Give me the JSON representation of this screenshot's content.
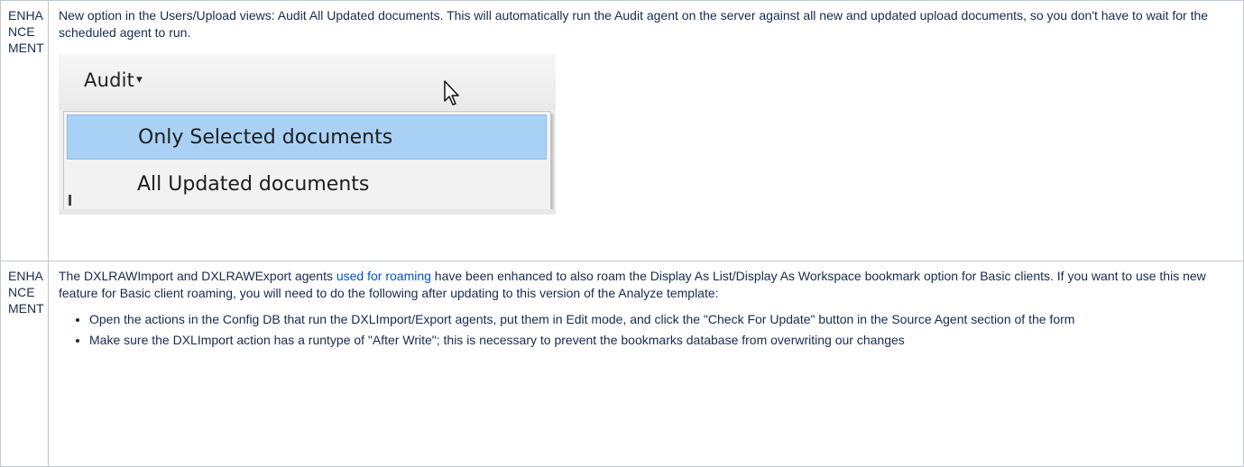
{
  "rows": [
    {
      "type": "ENHANCEMENT",
      "description": "New option in the Users/Upload views: Audit All Updated documents. This will automatically run the Audit agent on the server against all new and updated upload documents, so you don't have to wait for the scheduled agent to run.",
      "screenshot": {
        "menu_button": "Audit",
        "caret": "▾",
        "items": [
          "Only Selected documents",
          "All Updated documents"
        ],
        "selected_index": 0
      }
    },
    {
      "type": "ENHANCEMENT",
      "desc_before_link": "The DXLRAWImport and DXLRAWExport agents ",
      "link_text": "used for roaming",
      "desc_after_link": " have been enhanced to also roam the Display As List/Display As Workspace bookmark option for Basic clients. If you want to use this new feature for Basic client roaming, you will need to do the following after updating to this version of the Analyze template:",
      "bullets": [
        "Open the actions in the Config DB that run the DXLImport/Export agents, put them in Edit mode, and click the \"Check For Update\" button in the Source Agent section of the form",
        "Make sure the DXLImport action has a runtype of \"After Write\"; this is necessary to prevent the bookmarks database from overwriting our changes"
      ]
    }
  ],
  "colors": {
    "link": "#0052cc",
    "border": "#c1c7d0",
    "menu_highlight": "#a9d1f5"
  }
}
